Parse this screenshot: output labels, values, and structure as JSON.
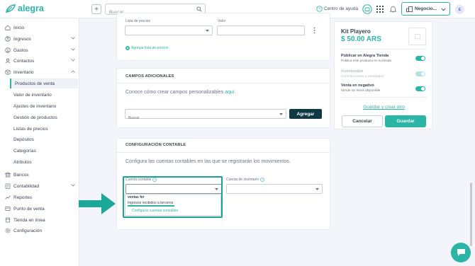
{
  "colors": {
    "accent": "#2bb5a5",
    "dark_button": "#0f3a44",
    "highlight": "#17a493"
  },
  "topbar": {
    "brand": "alegra",
    "search_placeholder": "Buscar...",
    "help_label": "Centro de ayuda",
    "company_label": "Negocio...",
    "avatar_initial": "E",
    "icons": [
      "plus-icon",
      "search-icon",
      "help-icon",
      "wallet-icon",
      "apps-grid-icon",
      "bell-icon",
      "company-icon",
      "chevron-down-icon"
    ]
  },
  "sidebar": {
    "items": [
      {
        "label": "Inicio",
        "icon": "home-icon"
      },
      {
        "label": "Ingresos",
        "icon": "income-icon"
      },
      {
        "label": "Gastos",
        "icon": "expenses-icon"
      },
      {
        "label": "Contactos",
        "icon": "contacts-icon"
      },
      {
        "label": "Inventario",
        "icon": "inventory-icon"
      }
    ],
    "inventory_sub": [
      "Productos de venta",
      "Valor de inventario",
      "Ajustes de inventario",
      "Gestión de productos",
      "Listas de precios",
      "Depósitos",
      "Categorías",
      "Atributos"
    ],
    "active_sub": "Productos de venta",
    "bottom_items": [
      {
        "label": "Bancos",
        "icon": "bank-icon"
      },
      {
        "label": "Contabilidad",
        "icon": "accounting-icon"
      },
      {
        "label": "Reportes",
        "icon": "reports-icon"
      },
      {
        "label": "Punto de venta",
        "icon": "pos-icon"
      },
      {
        "label": "Tienda en línea",
        "icon": "store-icon"
      },
      {
        "label": "Configuración",
        "icon": "settings-icon"
      }
    ]
  },
  "price_section": {
    "price_list_label": "Lista de precios",
    "value_label": "Valor",
    "add_price_list": "Agregar lista de precios"
  },
  "extra_fields": {
    "title": "CAMPOS ADICIONALES",
    "text": "Conoce cómo crear campos personalizables",
    "link": "aquí.",
    "search_placeholder": "Buscar",
    "add_button": "Agregar"
  },
  "accounting": {
    "title": "CONFIGURACIÓN CONTABLE",
    "text": "Configura las cuentas contables en las que se registrarán los movimientos.",
    "account_label": "Cuenta contable",
    "inventory_account_label": "Cuenta de inventario",
    "options": [
      "ventas fer",
      "Ingresos recibidos a terceros"
    ],
    "configure_link": "Configurar cuentas contables"
  },
  "product_card": {
    "name": "Kit Playero",
    "price": "$ 50.00 ARS",
    "toggles": [
      {
        "title": "Publicar en Alegra Tienda",
        "subtitle": "Publica este producto en tu tienda",
        "on": true
      },
      {
        "title": "Inventariable",
        "subtitle": "Controla costos y cantidades",
        "on": false
      },
      {
        "title": "Venta en negativo",
        "subtitle": "Vende sin stock disponible",
        "on": true
      }
    ],
    "save_create_link": "Guardar y crear otro",
    "cancel_button": "Cancelar",
    "save_button": "Guardar"
  }
}
